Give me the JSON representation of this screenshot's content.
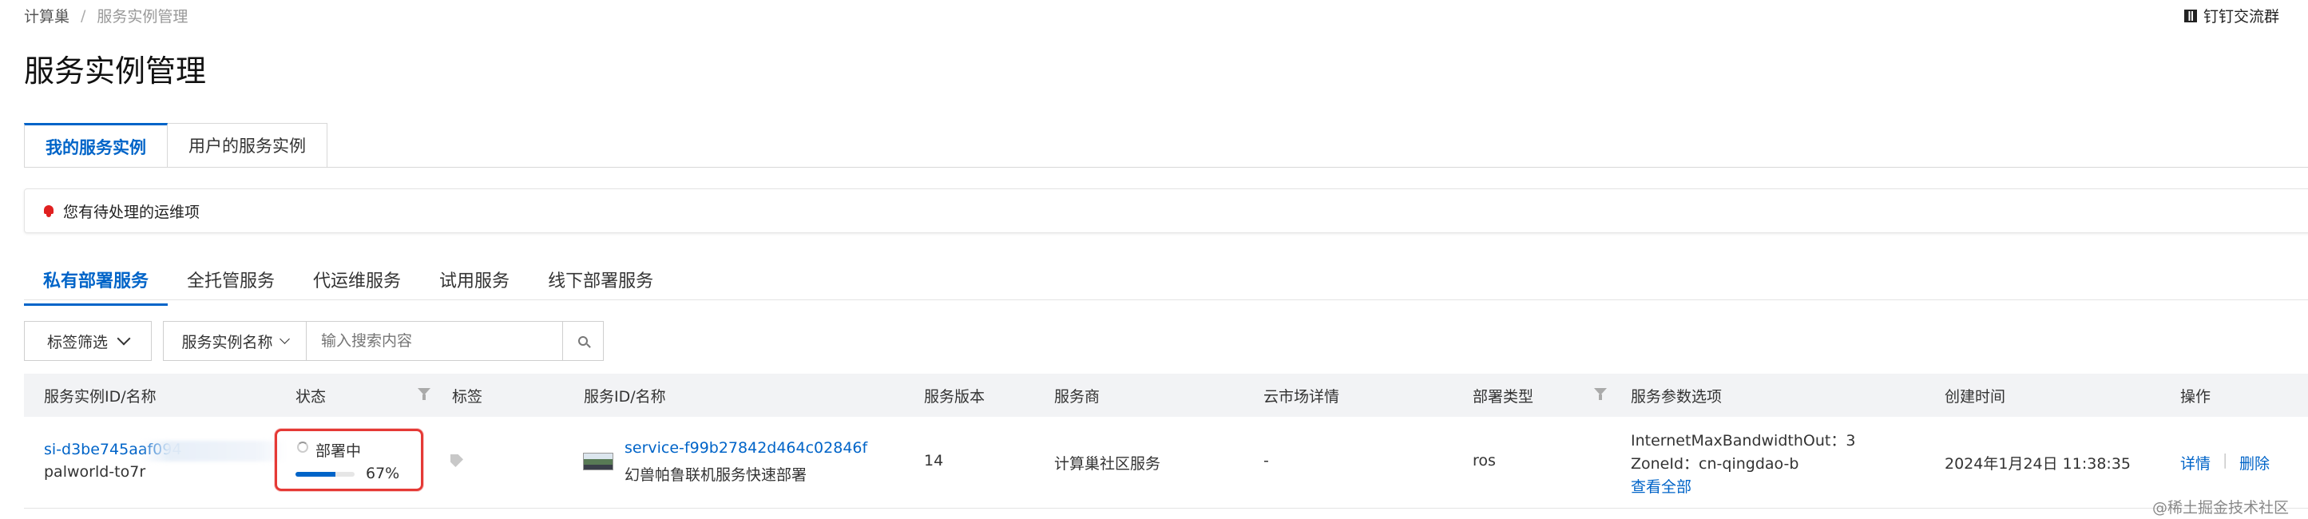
{
  "breadcrumb": {
    "root": "计算巢",
    "separator": "/",
    "current": "服务实例管理"
  },
  "dingtalk_label": "钉钉交流群",
  "page_title": "服务实例管理",
  "top_tabs": [
    "我的服务实例",
    "用户的服务实例"
  ],
  "alert_text": "您有待处理的运维项",
  "sub_tabs": [
    "私有部署服务",
    "全托管服务",
    "代运维服务",
    "试用服务",
    "线下部署服务"
  ],
  "filters": {
    "tag_filter_label": "标签筛选",
    "search_field_label": "服务实例名称",
    "search_placeholder": "输入搜索内容"
  },
  "table": {
    "headers": {
      "instance": "服务实例ID/名称",
      "status": "状态",
      "tags": "标签",
      "service": "服务ID/名称",
      "version": "服务版本",
      "provider": "服务商",
      "marketplace": "云市场详情",
      "deploy_type": "部署类型",
      "params": "服务参数选项",
      "created": "创建时间",
      "actions": "操作"
    },
    "rows": [
      {
        "instance_id": "si-d3be745aaf094",
        "instance_name": "palworld-to7r",
        "status_text": "部署中",
        "progress_label": "67%",
        "progress": 0.67,
        "service_id": "service-f99b27842d464c02846f",
        "service_name": "幻兽帕鲁联机服务快速部署",
        "version": "14",
        "provider": "计算巢社区服务",
        "marketplace": "-",
        "deploy_type": "ros",
        "param_1": "InternetMaxBandwidthOut：3",
        "param_2": "ZoneId：cn-qingdao-b",
        "param_more": "查看全部",
        "created": "2024年1月24日 11:38:35",
        "action_detail": "详情",
        "action_sep": "|",
        "action_delete": "删除"
      }
    ]
  },
  "watermark": "@稀土掘金技术社区"
}
